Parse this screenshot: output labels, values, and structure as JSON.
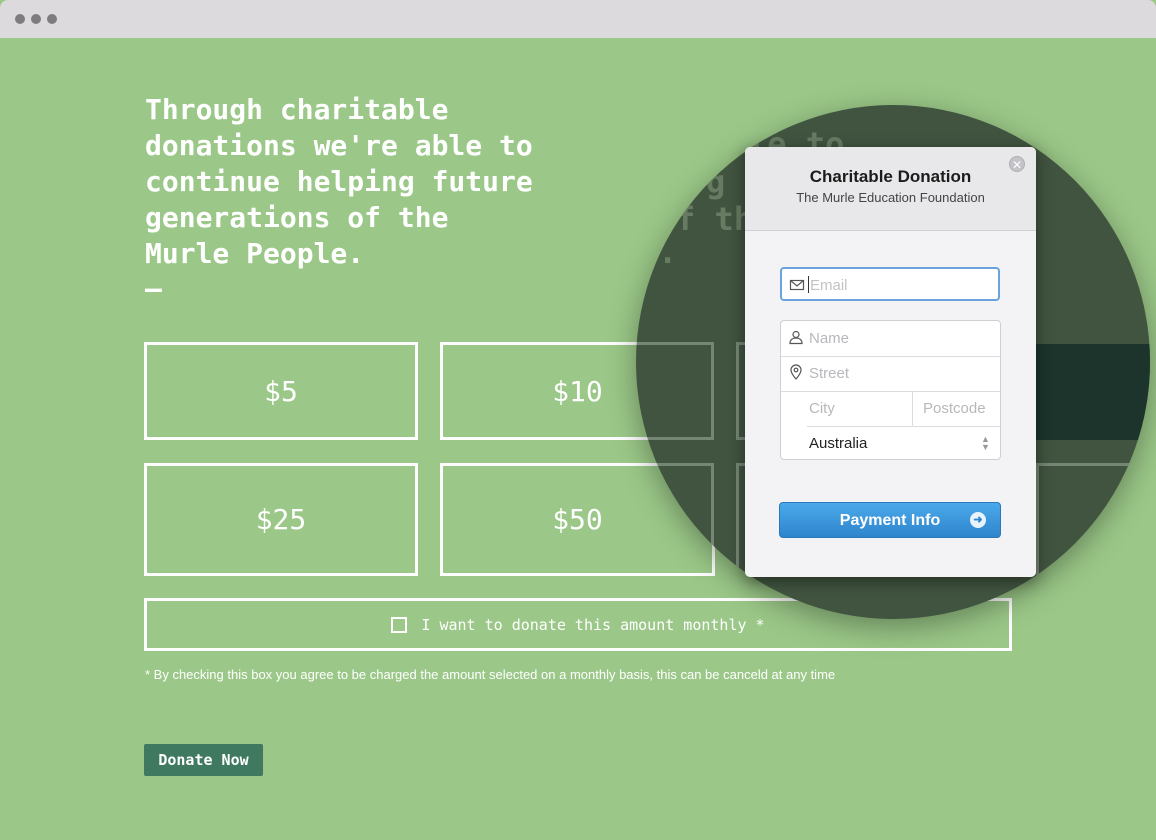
{
  "headline": "Through charitable\ndonations we're able to\ncontinue helping future\ngenerations of the\nMurle People.",
  "dash": "–",
  "amounts": [
    "$5",
    "$10",
    "$25",
    "$50"
  ],
  "monthly_label": "I want to donate this amount monthly *",
  "footnote": "* By checking this box you agree to be charged the amount selected on a monthly basis, this can be canceld at any time",
  "donate_button": "Donate Now",
  "ghost_lines": [
    "le to",
    "g",
    "f th",
    "."
  ],
  "modal": {
    "title": "Charitable Donation",
    "subtitle": "The Murle Education Foundation",
    "close_icon": "close-icon",
    "email_placeholder": "Email",
    "name_placeholder": "Name",
    "street_placeholder": "Street",
    "city_placeholder": "City",
    "postcode_placeholder": "Postcode",
    "country": "Australia",
    "pay_button": "Payment Info"
  },
  "colors": {
    "page_bg": "#9bc888",
    "donate_bg": "#3f7a60",
    "pay_button": "#3a97dc",
    "email_focus": "#6aa3de"
  }
}
